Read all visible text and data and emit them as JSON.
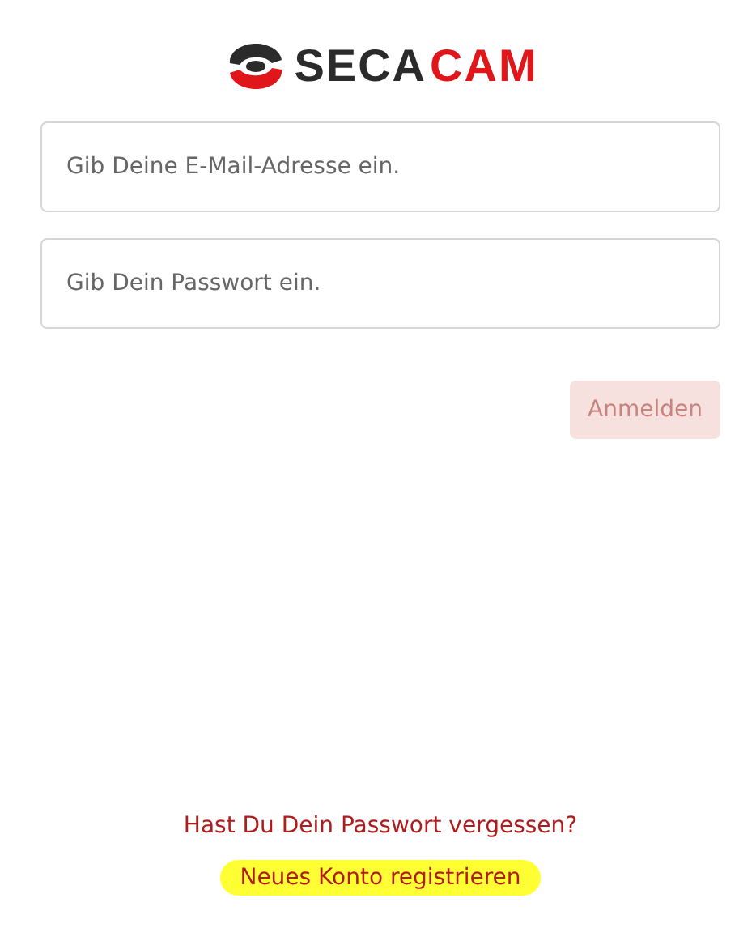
{
  "logo": {
    "dark_part": "SECA",
    "red_part": "CAM"
  },
  "fields": [
    {
      "placeholder": "Gib Deine E-Mail-Adresse ein."
    },
    {
      "placeholder": "Gib Dein Passwort ein."
    }
  ],
  "login_button": {
    "label": "Anmelden",
    "disabled": true
  },
  "links": [
    {
      "label": "Hast Du Dein Passwort vergessen?",
      "highlighted": false
    },
    {
      "label": "Neues Konto registrieren",
      "highlighted": true
    }
  ]
}
